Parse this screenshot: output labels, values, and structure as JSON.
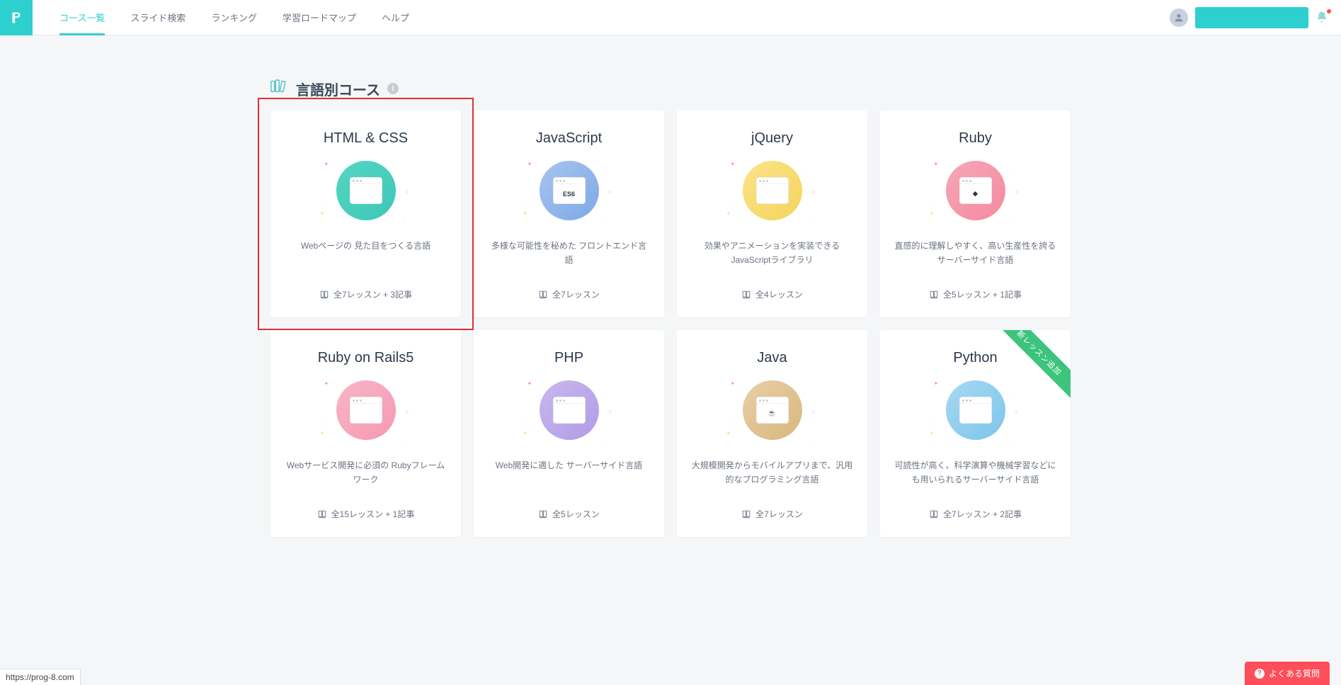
{
  "header": {
    "nav": [
      {
        "label": "コース一覧",
        "active": true
      },
      {
        "label": "スライド検索",
        "active": false
      },
      {
        "label": "ランキング",
        "active": false
      },
      {
        "label": "学習ロードマップ",
        "active": false
      },
      {
        "label": "ヘルプ",
        "active": false
      }
    ]
  },
  "section": {
    "title": "言語別コース"
  },
  "courses": [
    {
      "title": "HTML & CSS",
      "desc": "Webページの 見た目をつくる言語",
      "lessons": "全7レッスン + 3記事",
      "iconClass": "bg-teal",
      "iconInner": "",
      "highlighted": true
    },
    {
      "title": "JavaScript",
      "desc": "多様な可能性を秘めた フロントエンド言語",
      "lessons": "全7レッスン",
      "iconClass": "bg-blue",
      "iconInner": "ES6"
    },
    {
      "title": "jQuery",
      "desc": "効果やアニメーションを実装できる JavaScriptライブラリ",
      "lessons": "全4レッスン",
      "iconClass": "bg-yellow",
      "iconInner": ""
    },
    {
      "title": "Ruby",
      "desc": "直感的に理解しやすく、高い生産性を誇る サーバーサイド言語",
      "lessons": "全5レッスン + 1記事",
      "iconClass": "bg-pink",
      "iconInner": "◆"
    },
    {
      "title": "Ruby on Rails5",
      "desc": "Webサービス開発に必須の Rubyフレームワーク",
      "lessons": "全15レッスン + 1記事",
      "iconClass": "bg-rose",
      "iconInner": ""
    },
    {
      "title": "PHP",
      "desc": "Web開発に適した サーバーサイド言語",
      "lessons": "全5レッスン",
      "iconClass": "bg-purple",
      "iconInner": ""
    },
    {
      "title": "Java",
      "desc": "大規模開発からモバイルアプリまで、汎用的なプログラミング言語",
      "lessons": "全7レッスン",
      "iconClass": "bg-brown",
      "iconInner": "☕"
    },
    {
      "title": "Python",
      "desc": "可読性が高く、科学演算や機械学習などにも用いられるサーバーサイド言語",
      "lessons": "全7レッスン + 2記事",
      "iconClass": "bg-sky",
      "iconInner": "",
      "ribbon": "新レッスン追加"
    }
  ],
  "faq": {
    "label": "よくある質問"
  },
  "status": {
    "url": "https://prog-8.com"
  }
}
